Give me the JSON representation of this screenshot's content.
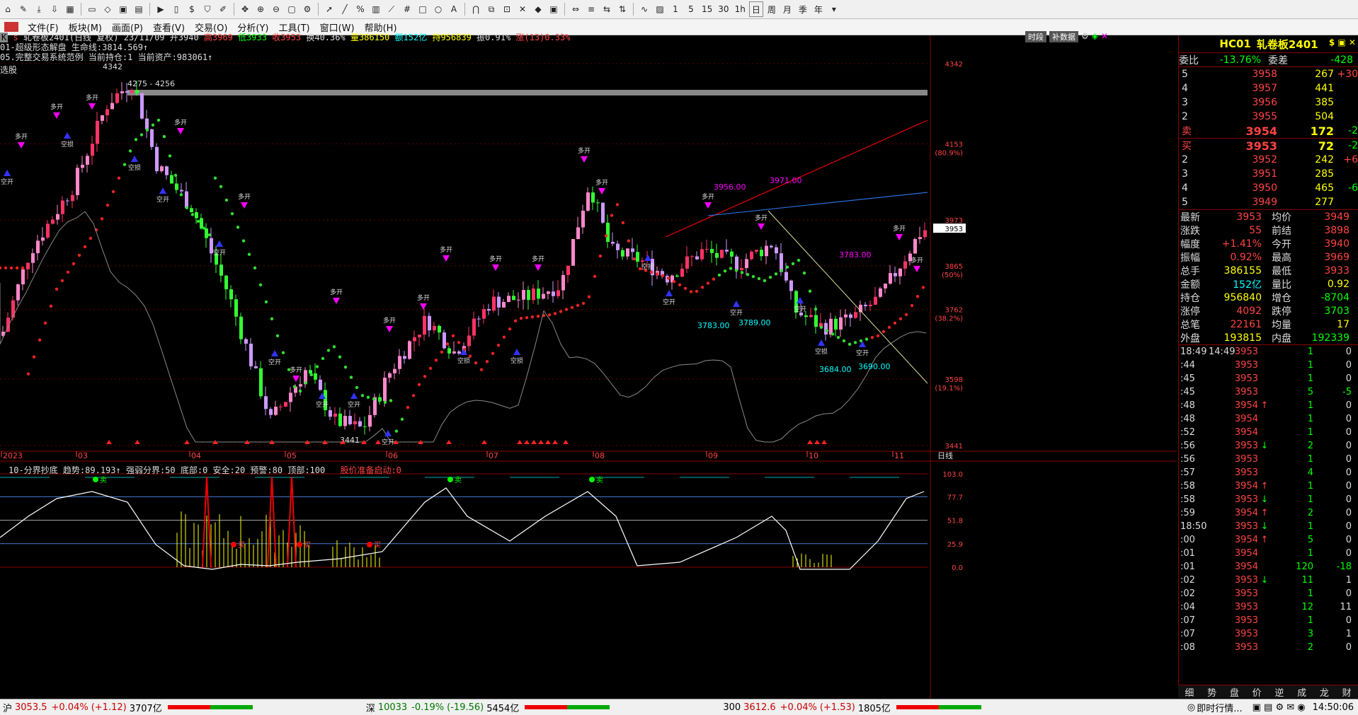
{
  "toolbar": {
    "right_labels": [
      "1",
      "5",
      "15",
      "30",
      "1h",
      "日",
      "周",
      "月",
      "季",
      "年"
    ]
  },
  "menu": [
    "文件(F)",
    "板块(M)",
    "画面(P)",
    "查看(V)",
    "交易(O)",
    "分析(Y)",
    "工具(T)",
    "窗口(W)",
    "帮助(H)"
  ],
  "header": {
    "title": "轧卷板2401(日线 复权) 23/11/09",
    "open": "开3940",
    "high": "高3969",
    "low": "低3933",
    "close": "收3953",
    "turnover": "换40.36%",
    "volume": "量386150",
    "amount": "额152亿",
    "hold": "持956839",
    "amplitude": "振0.91%",
    "change": "涨(13)0.33%",
    "btn1": "时段",
    "btn2": "补数据",
    "line2": "01-超级形态解盘 生命线:3814.569↑",
    "line3": "05.完整交易系统范例 当前持仓:1 当前资产:983061↑",
    "select_label": "选股"
  },
  "chart_data": [
    {
      "type": "candlestick",
      "title": "轧卷板2401(日线 复权) 23/11/09",
      "y_ticks": [
        "4342",
        "4153",
        "3973",
        "3953",
        "3865",
        "3762",
        "3598",
        "3441"
      ],
      "y_pct": [
        "(80.9%)",
        "(50%)",
        "(38.2%)",
        "(19.1%)"
      ],
      "x_labels": [
        "2023",
        "03",
        "04",
        "05",
        "06",
        "07",
        "08",
        "09",
        "10",
        "11"
      ],
      "annotations": [
        "4342",
        "4275 - 4256",
        "3956.00",
        "3971.00",
        "3783.00",
        "3783.00",
        "3789.00",
        "3684.00",
        "3690.00",
        "3441"
      ],
      "signals": [
        "多开",
        "空开",
        "空损",
        "多损",
        "-1",
        "1"
      ]
    },
    {
      "type": "line",
      "title": "10-分界抄底",
      "params": "趋势:89.193↑ 强弱分界:50 底部:0 安全:20 预警:80 顶部:100",
      "alert": "股价准备启动:0",
      "y_ticks": [
        "103.0",
        "77.7",
        "51.8",
        "25.9",
        "0.0"
      ],
      "signals": [
        "卖",
        "买"
      ]
    }
  ],
  "xaxis_right": "日线",
  "quote": {
    "code": "HC01",
    "name": "轧卷板2401",
    "weibi_label": "委比",
    "weibi": "-13.76%",
    "weicha_label": "委差",
    "weicha": "-428",
    "asks": [
      {
        "lv": "5",
        "price": "3958",
        "vol": "267",
        "chg": "+30"
      },
      {
        "lv": "4",
        "price": "3957",
        "vol": "441",
        "chg": ""
      },
      {
        "lv": "3",
        "price": "3956",
        "vol": "385",
        "chg": ""
      },
      {
        "lv": "2",
        "price": "3955",
        "vol": "504",
        "chg": ""
      },
      {
        "lv": "卖",
        "price": "3954",
        "vol": "172",
        "chg": "-2"
      }
    ],
    "bids": [
      {
        "lv": "买",
        "price": "3953",
        "vol": "72",
        "chg": "-2"
      },
      {
        "lv": "2",
        "price": "3952",
        "vol": "242",
        "chg": "+6"
      },
      {
        "lv": "3",
        "price": "3951",
        "vol": "285",
        "chg": ""
      },
      {
        "lv": "4",
        "price": "3950",
        "vol": "465",
        "chg": "-6"
      },
      {
        "lv": "5",
        "price": "3949",
        "vol": "277",
        "chg": ""
      }
    ],
    "stats": [
      [
        "最新",
        "3953",
        "均价",
        "3949"
      ],
      [
        "涨跌",
        "55",
        "前结",
        "3898"
      ],
      [
        "幅度",
        "+1.41%",
        "今开",
        "3940"
      ],
      [
        "振幅",
        "0.92%",
        "最高",
        "3969"
      ],
      [
        "总手",
        "386155",
        "最低",
        "3933"
      ],
      [
        "金额",
        "152亿",
        "量比",
        "0.92"
      ],
      [
        "持仓",
        "956840",
        "增仓",
        "-8704"
      ],
      [
        "涨停",
        "4092",
        "跌停",
        "3703"
      ],
      [
        "总笔",
        "22161",
        "均量",
        "17"
      ],
      [
        "外盘",
        "193815",
        "内盘",
        "192339"
      ]
    ],
    "ticks": [
      [
        "18:49",
        "14:49",
        "3953",
        "",
        "1",
        "0"
      ],
      [
        ":44",
        "",
        "3953",
        "",
        "1",
        "0"
      ],
      [
        ":45",
        "",
        "3953",
        "",
        "1",
        "0"
      ],
      [
        ":45",
        "",
        "3953",
        "",
        "5",
        "-5"
      ],
      [
        ":48",
        "",
        "3954",
        "↑",
        "1",
        "0"
      ],
      [
        ":48",
        "",
        "3954",
        "",
        "1",
        "0"
      ],
      [
        ":52",
        "",
        "3954",
        "",
        "1",
        "0"
      ],
      [
        ":56",
        "",
        "3953",
        "↓",
        "2",
        "0"
      ],
      [
        ":56",
        "",
        "3953",
        "",
        "1",
        "0"
      ],
      [
        ":57",
        "",
        "3953",
        "",
        "4",
        "0"
      ],
      [
        ":58",
        "",
        "3954",
        "↑",
        "1",
        "0"
      ],
      [
        ":58",
        "",
        "3953",
        "↓",
        "1",
        "0"
      ],
      [
        ":59",
        "",
        "3954",
        "↑",
        "2",
        "0"
      ],
      [
        "18:50",
        "",
        "3953",
        "↓",
        "1",
        "0"
      ],
      [
        ":00",
        "",
        "3954",
        "↑",
        "5",
        "0"
      ],
      [
        ":01",
        "",
        "3954",
        "",
        "1",
        "0"
      ],
      [
        ":01",
        "",
        "3954",
        "",
        "120",
        "-18"
      ],
      [
        ":02",
        "",
        "3953",
        "↓",
        "11",
        "1"
      ],
      [
        ":02",
        "",
        "3953",
        "",
        "1",
        "0"
      ],
      [
        ":04",
        "",
        "3953",
        "",
        "12",
        "11"
      ],
      [
        ":07",
        "",
        "3953",
        "",
        "1",
        "0"
      ],
      [
        ":07",
        "",
        "3953",
        "",
        "3",
        "1"
      ],
      [
        ":08",
        "",
        "3953",
        "",
        "2",
        "0"
      ]
    ],
    "tabs": [
      "细",
      "势",
      "盘",
      "价",
      "逆",
      "成",
      "龙",
      "财"
    ]
  },
  "status": {
    "sh_label": "沪",
    "sh": "3053.5",
    "sh_chg": "+0.04%",
    "sh_delta": "(+1.12)",
    "sh_amt": "3707亿",
    "sz_label": "深",
    "sz": "10033",
    "sz_chg": "-0.19%",
    "sz_delta": "(-19.56)",
    "sz_amt": "5454亿",
    "c300_label": "300",
    "c300": "3612.6",
    "c300_chg": "+0.04%",
    "c300_delta": "(+1.53)",
    "c300_amt": "1805亿",
    "realtime": "即时行情...",
    "time": "14:50:06"
  }
}
